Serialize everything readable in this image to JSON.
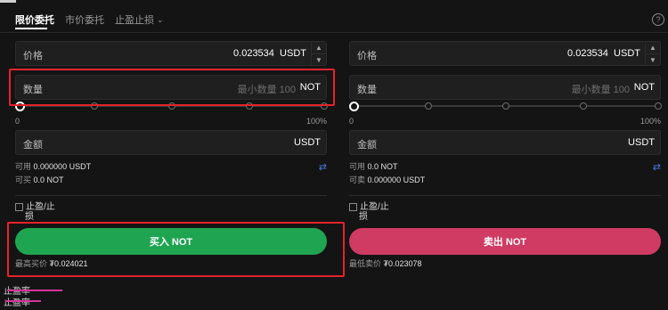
{
  "tabs": [
    {
      "label": "限价委托"
    },
    {
      "label": "市价委托"
    },
    {
      "label": "止盈止损"
    }
  ],
  "buy": {
    "price_label": "价格",
    "price_value": "0.023534",
    "price_unit": "USDT",
    "qty_label": "数量",
    "qty_placeholder": "最小数量 100",
    "qty_unit": "NOT",
    "slider_min": "0",
    "slider_max": "100%",
    "amount_label": "金额",
    "amount_unit": "USDT",
    "avail_label": "可用",
    "avail_value": "0.000000 USDT",
    "can_label": "可买",
    "can_value": "0.0 NOT",
    "sltp_line1": "止盈/止",
    "sltp_line2": "损",
    "button": "买入 NOT",
    "best_label": "最高买价",
    "best_value": "₮0.024021"
  },
  "sell": {
    "price_label": "价格",
    "price_value": "0.023534",
    "price_unit": "USDT",
    "qty_label": "数量",
    "qty_placeholder": "最小数量 100",
    "qty_unit": "NOT",
    "slider_min": "0",
    "slider_max": "100%",
    "amount_label": "金额",
    "amount_unit": "USDT",
    "avail_label": "可用",
    "avail_value": "0.0 NOT",
    "can_label": "可卖",
    "can_value": "0.000000 USDT",
    "sltp_line1": "止盈/止",
    "sltp_line2": "损",
    "button": "卖出 NOT",
    "best_label": "最低卖价",
    "best_value": "₮0.023078"
  },
  "footer": {
    "line1": "止盈率",
    "line2": "止盈率"
  },
  "colors": {
    "buy": "#1fa552",
    "sell": "#d03b63",
    "highlight": "#e5232a",
    "swap": "#4a78e8"
  }
}
